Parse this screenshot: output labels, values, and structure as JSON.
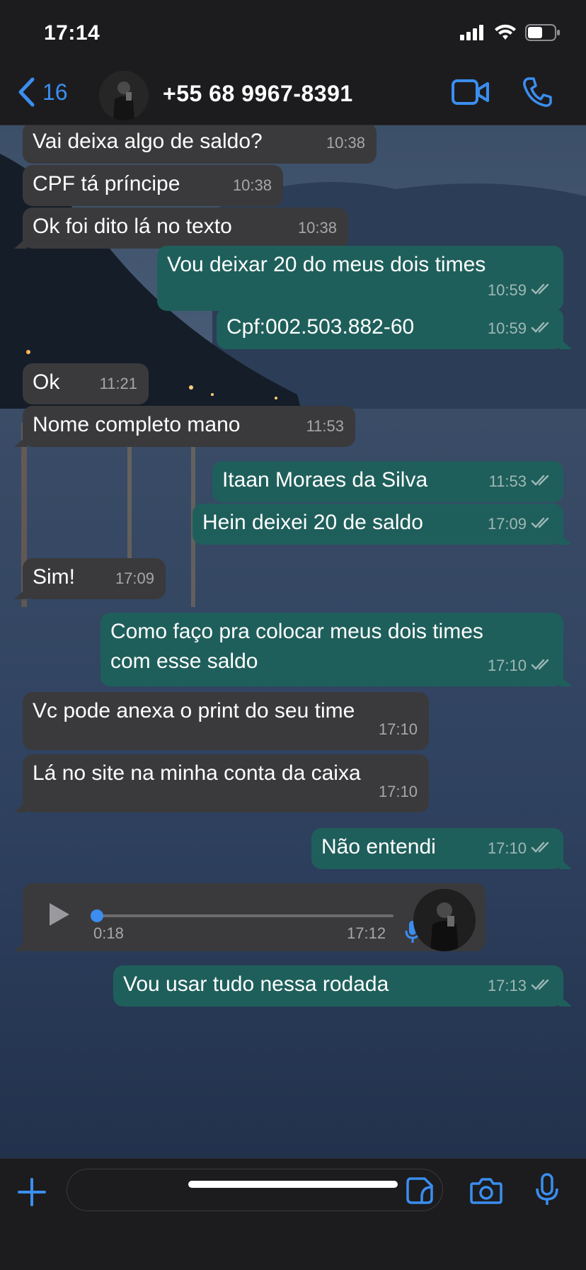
{
  "status_bar": {
    "time": "17:14"
  },
  "header": {
    "back_count": "16",
    "contact_name": "+55 68 9967-8391"
  },
  "colors": {
    "accent": "#3b8ef0",
    "incoming_bubble": "#3a3a3c",
    "outgoing_bubble": "#1f5f5b",
    "background": "#1c1c1e"
  },
  "messages": [
    {
      "direction": "in",
      "text": "Vai deixa algo de saldo?",
      "time": "10:38"
    },
    {
      "direction": "in",
      "text": "CPF tá príncipe",
      "time": "10:38"
    },
    {
      "direction": "in",
      "text": "Ok foi dito lá no texto",
      "time": "10:38"
    },
    {
      "direction": "out",
      "text": "Vou deixar 20 do meus dois times",
      "time": "10:59",
      "status": "read"
    },
    {
      "direction": "out",
      "text": "Cpf:002.503.882-60",
      "time": "10:59",
      "status": "read"
    },
    {
      "direction": "in",
      "text": "Ok",
      "time": "11:21"
    },
    {
      "direction": "in",
      "text": "Nome completo mano",
      "time": "11:53"
    },
    {
      "direction": "out",
      "text": "Itaan Moraes da Silva",
      "time": "11:53",
      "status": "read"
    },
    {
      "direction": "out",
      "text": "Hein deixei 20 de saldo",
      "time": "17:09",
      "status": "read"
    },
    {
      "direction": "in",
      "text": "Sim!",
      "time": "17:09"
    },
    {
      "direction": "out",
      "text": "Como faço pra colocar meus dois times\ncom esse saldo",
      "time": "17:10",
      "status": "read"
    },
    {
      "direction": "in",
      "text": "Vc pode anexa o print do seu time",
      "time": "17:10"
    },
    {
      "direction": "in",
      "text": "Lá no site na minha conta da caixa",
      "time": "17:10"
    },
    {
      "direction": "out",
      "text": "Não entendi",
      "time": "17:10",
      "status": "read"
    },
    {
      "direction": "out",
      "text": "Vou usar tudo nessa rodada",
      "time": "17:13",
      "status": "read"
    }
  ],
  "voice_message": {
    "direction": "in",
    "duration": "0:18",
    "time": "17:12",
    "progress": 0
  },
  "input": {
    "placeholder": "",
    "value": ""
  },
  "icons": {
    "back": "chevron-left-icon",
    "video": "video-camera-icon",
    "call": "phone-icon",
    "plus": "plus-icon",
    "sticker": "sticker-icon",
    "camera": "camera-icon",
    "mic": "microphone-icon",
    "play": "play-icon",
    "read_receipt": "double-check-icon"
  }
}
